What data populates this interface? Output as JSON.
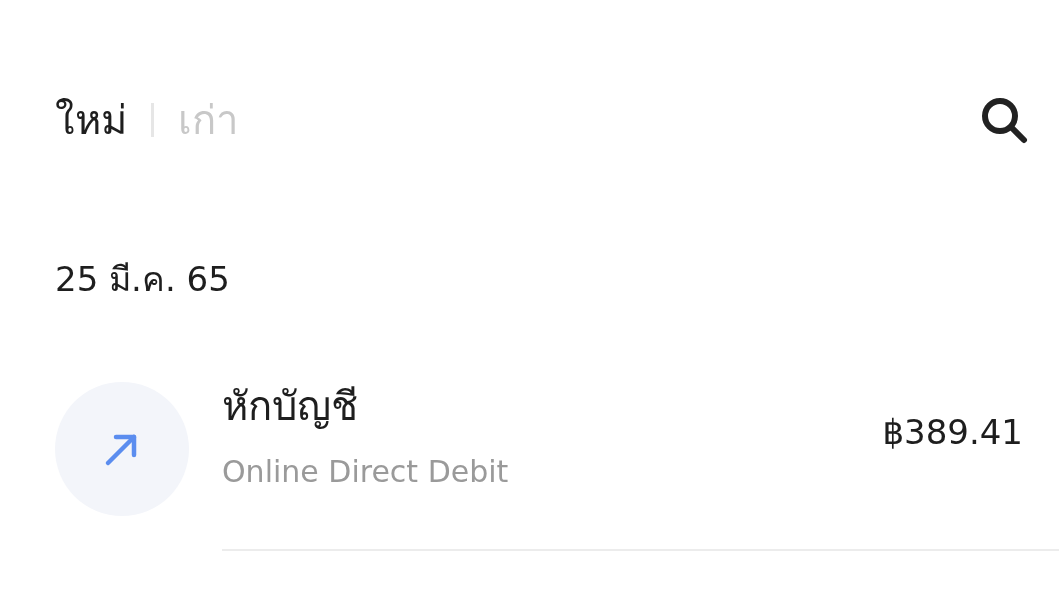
{
  "tabs": [
    {
      "label": "ใหม่",
      "selected": true
    },
    {
      "label": "เก่า",
      "selected": false
    }
  ],
  "groups": [
    {
      "date": "25 มี.ค. 65",
      "transactions": [
        {
          "kind": "outgoing",
          "title": "หักบัญชี",
          "subtitle": "Online Direct Debit",
          "amount": "฿389.41"
        }
      ]
    }
  ]
}
